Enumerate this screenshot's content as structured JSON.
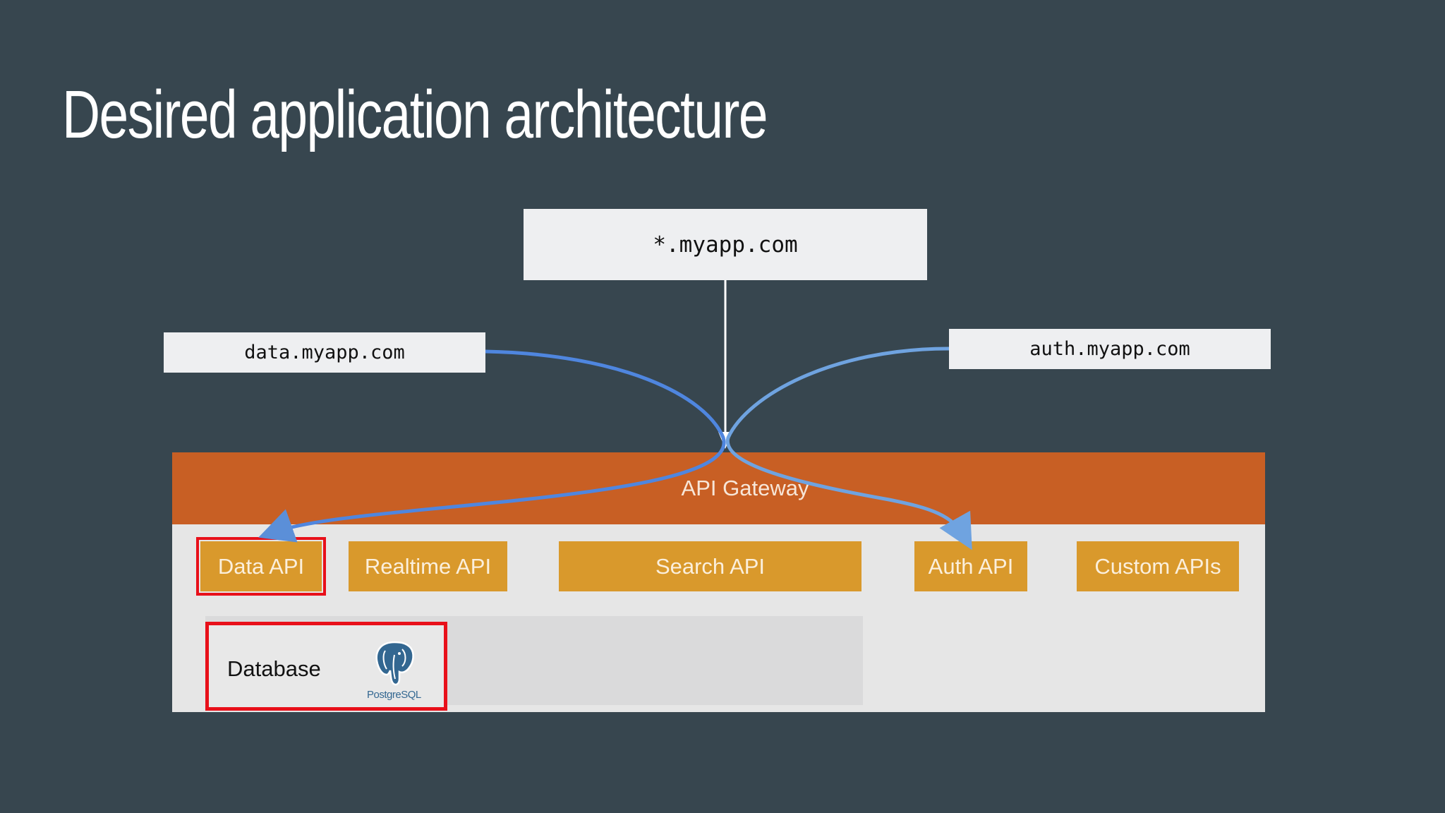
{
  "slide": {
    "title": "Desired application architecture",
    "background_color": "#37464f"
  },
  "domains": {
    "wildcard": "*.myapp.com",
    "data": "data.myapp.com",
    "auth": "auth.myapp.com"
  },
  "gateway": {
    "label": "API Gateway",
    "color": "#c85f24"
  },
  "apis": [
    {
      "label": "Data API",
      "highlighted": true
    },
    {
      "label": "Realtime API",
      "highlighted": false
    },
    {
      "label": "Search API",
      "highlighted": false
    },
    {
      "label": "Auth API",
      "highlighted": false
    },
    {
      "label": "Custom APIs",
      "highlighted": false
    }
  ],
  "api_color": "#d9992c",
  "highlight_color": "#e8101a",
  "database": {
    "label": "Database",
    "logo_text": "PostgreSQL",
    "logo_icon": "postgresql-elephant-icon",
    "highlighted": true
  }
}
